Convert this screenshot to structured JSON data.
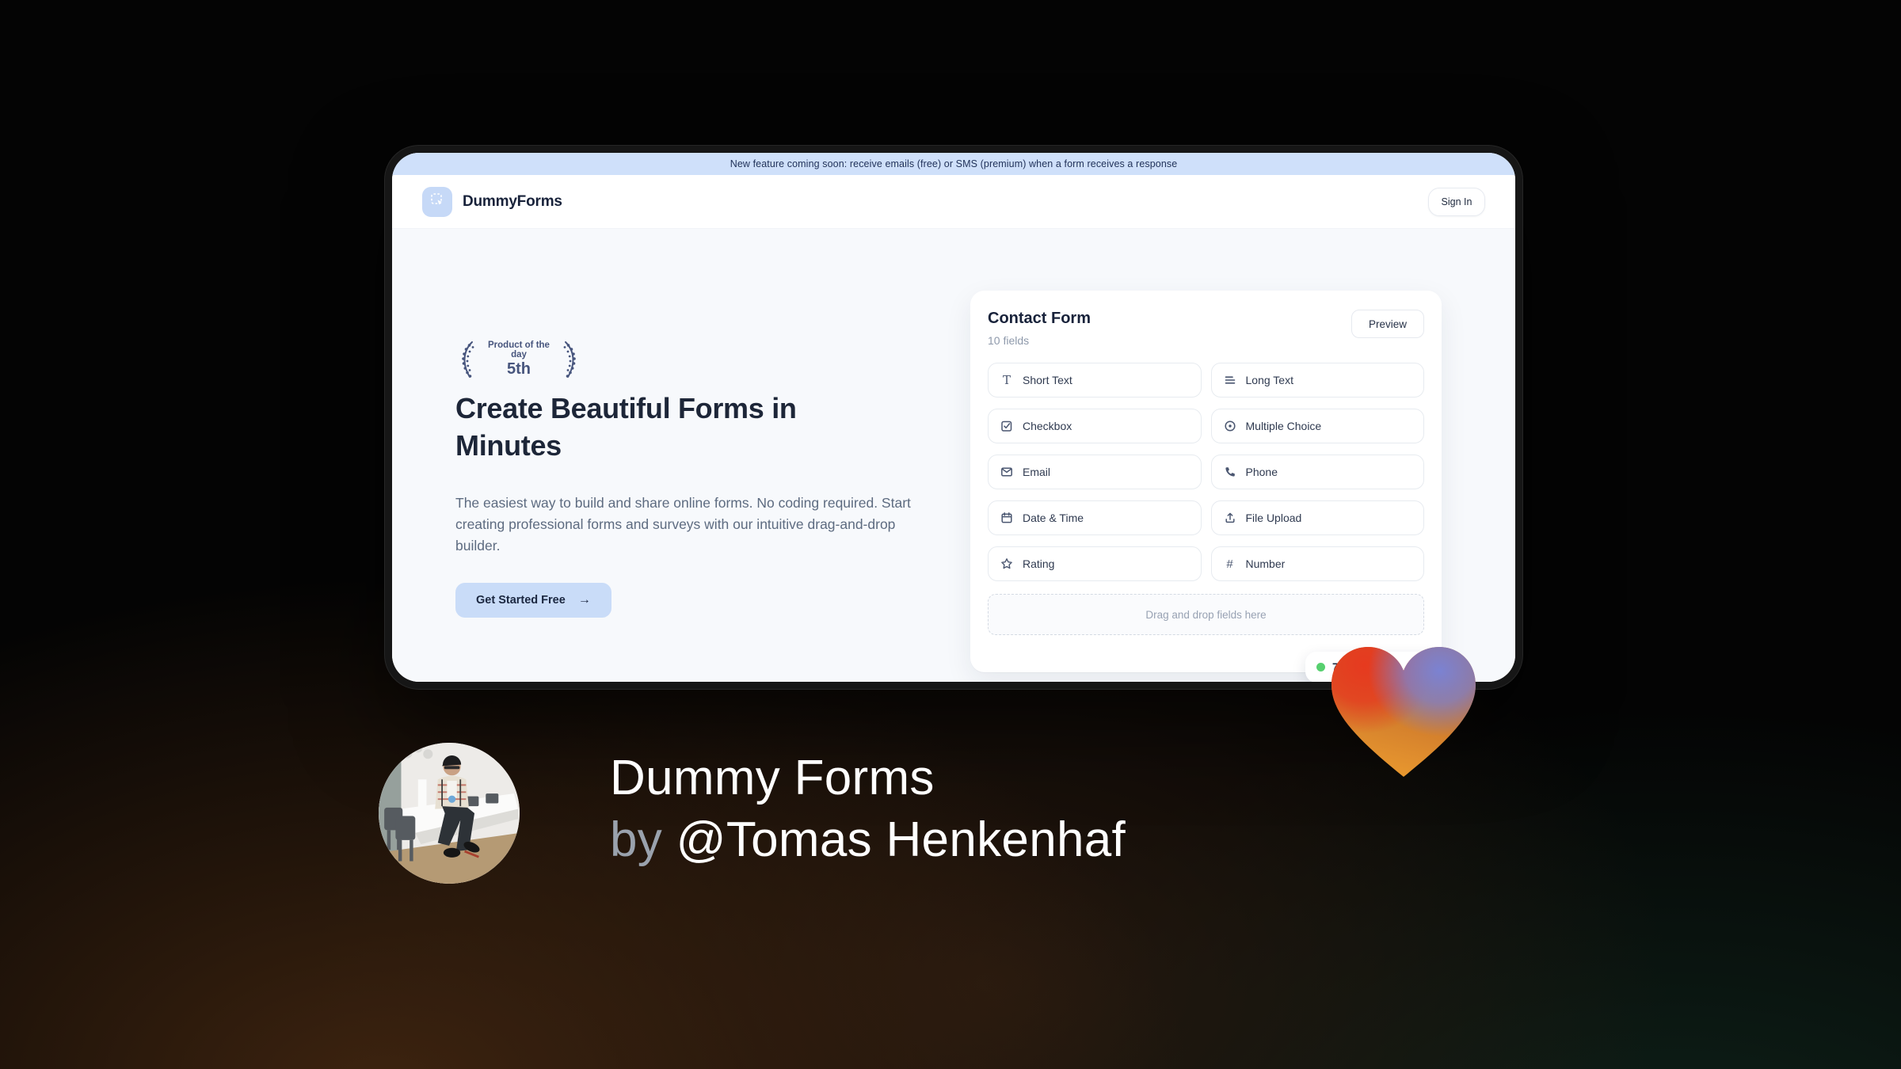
{
  "window": {
    "banner": {
      "text": "New feature coming soon: receive emails (free) or SMS (premium) when a form receives a response",
      "bg_color": "#cfe0fa"
    },
    "header": {
      "brand": "DummyForms",
      "sign_in_label": "Sign In"
    },
    "hero": {
      "award_badge": {
        "line1": "Product of the day",
        "line2": "5th"
      },
      "title": "Create Beautiful Forms in Minutes",
      "description": "The easiest way to build and share online forms. No coding required. Start creating professional forms and surveys with our intuitive drag-and-drop builder.",
      "cta_label": "Get Started Free",
      "cta_arrow": "→",
      "cta_bg_color": "#c9dcf8"
    },
    "form_card": {
      "title": "Contact Form",
      "subtitle": "10 fields",
      "preview_label": "Preview",
      "fields": [
        {
          "label": "Short Text",
          "icon": "short-text-icon"
        },
        {
          "label": "Long Text",
          "icon": "long-text-icon"
        },
        {
          "label": "Checkbox",
          "icon": "checkbox-icon"
        },
        {
          "label": "Multiple Choice",
          "icon": "multiple-choice-icon"
        },
        {
          "label": "Email",
          "icon": "email-icon"
        },
        {
          "label": "Phone",
          "icon": "phone-icon"
        },
        {
          "label": "Date & Time",
          "icon": "calendar-icon"
        },
        {
          "label": "File Upload",
          "icon": "upload-icon"
        },
        {
          "label": "Rating",
          "icon": "star-icon"
        },
        {
          "label": "Number",
          "icon": "hash-icon"
        }
      ],
      "dropzone_text": "Drag and drop fields here",
      "status_badge": {
        "visible_text": "7",
        "dot_color": "#57d06f"
      }
    }
  },
  "footer": {
    "product_name": "Dummy Forms",
    "byline_prefix": "by ",
    "author": "@Tomas Henkenhaf"
  },
  "colors": {
    "heart_red": "#e63a1f",
    "heart_blue": "#7b82d2",
    "heart_orange": "#f0a12f",
    "accent_blue": "#c6d9f7",
    "page_bg": "#040404"
  }
}
